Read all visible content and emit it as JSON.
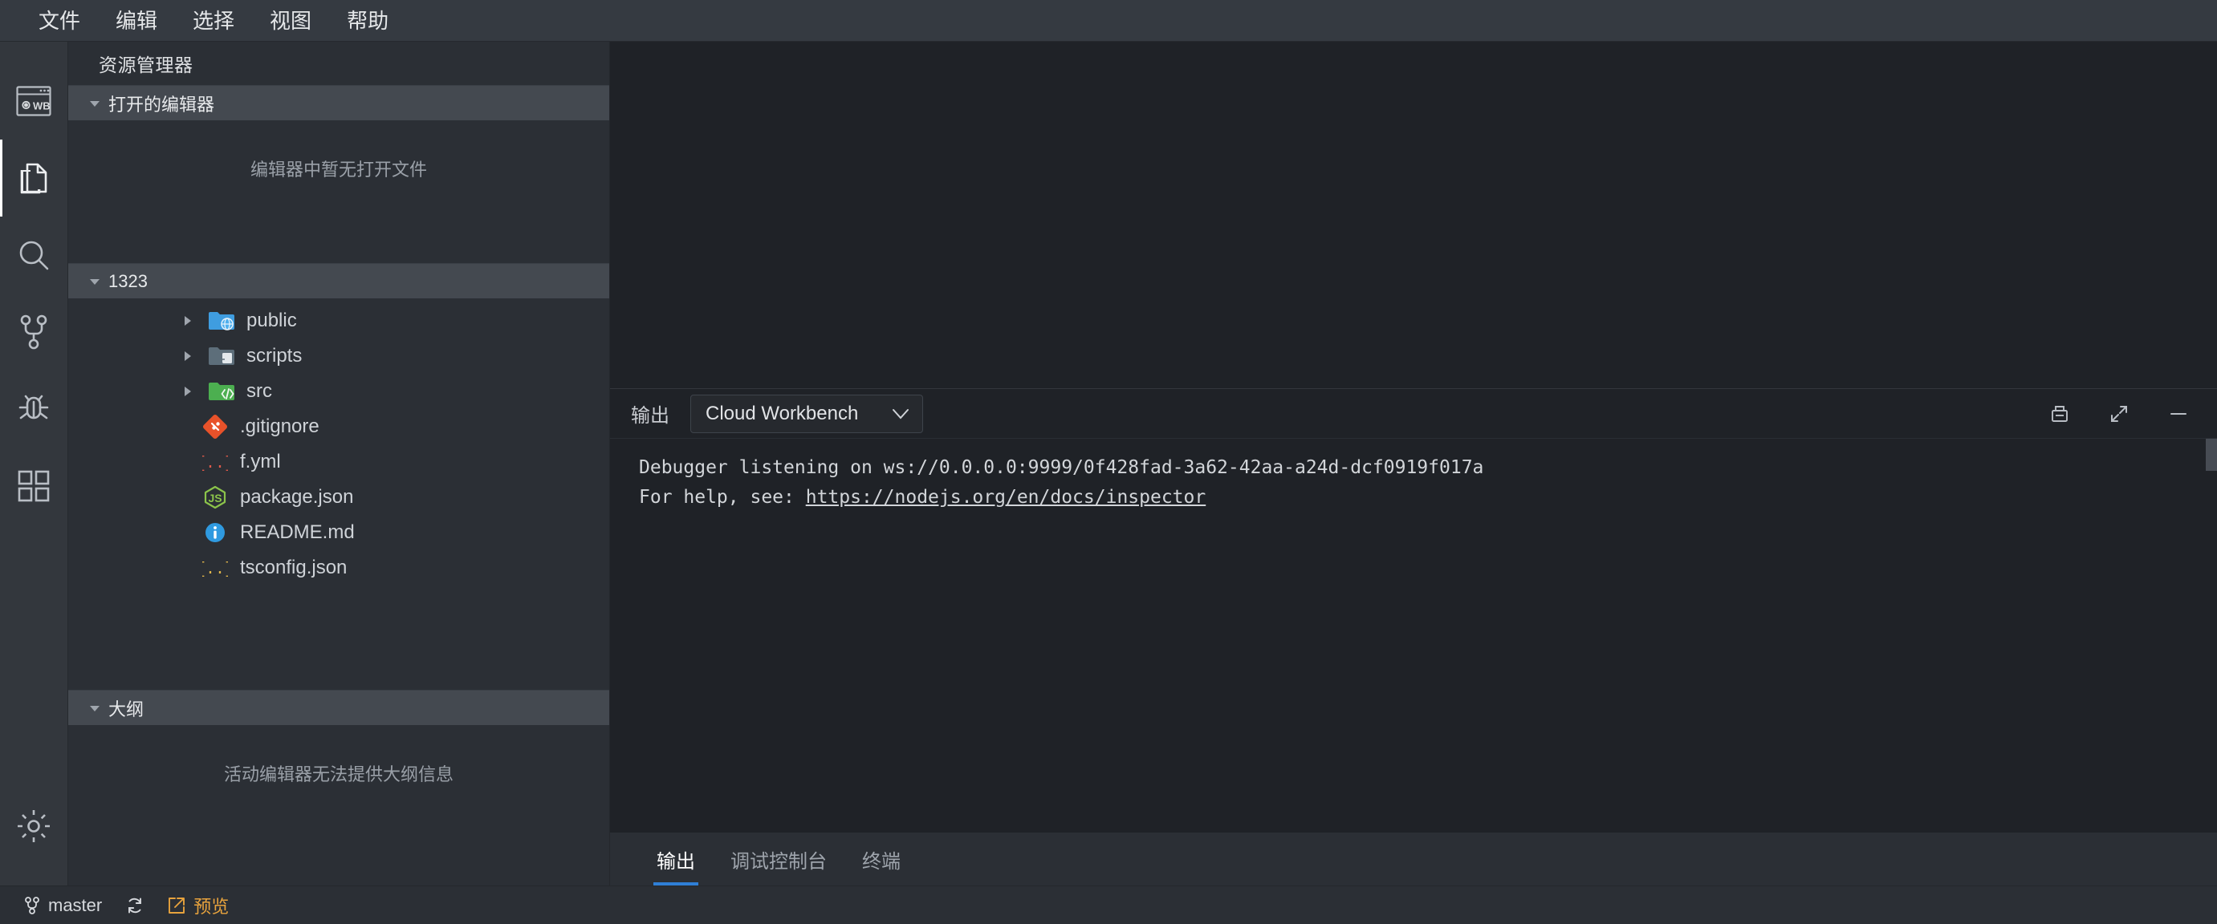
{
  "window": {
    "title": "Cloud Workbench"
  },
  "menubar": {
    "items": [
      {
        "label": "文件",
        "name": "menu-file"
      },
      {
        "label": "编辑",
        "name": "menu-edit"
      },
      {
        "label": "选择",
        "name": "menu-selection"
      },
      {
        "label": "视图",
        "name": "menu-view"
      },
      {
        "label": "帮助",
        "name": "menu-help"
      }
    ]
  },
  "activitybar": {
    "items": [
      {
        "icon": "workbench-wb-icon",
        "name": "activity-workbench",
        "active": false
      },
      {
        "icon": "files-explorer-icon",
        "name": "activity-explorer",
        "active": true
      },
      {
        "icon": "search-icon",
        "name": "activity-search",
        "active": false
      },
      {
        "icon": "source-control-icon",
        "name": "activity-source-control",
        "active": false
      },
      {
        "icon": "debug-bug-icon",
        "name": "activity-run-debug",
        "active": false
      },
      {
        "icon": "extensions-icon",
        "name": "activity-extensions",
        "active": false
      }
    ],
    "bottom": [
      {
        "icon": "gear-icon",
        "name": "activity-settings"
      }
    ]
  },
  "sidebar": {
    "title": "资源管理器",
    "open_editors": {
      "label": "打开的编辑器",
      "expanded": true,
      "empty_message": "编辑器中暂无打开文件"
    },
    "project": {
      "label": "1323",
      "expanded": true,
      "entries": [
        {
          "label": "public",
          "type": "folder",
          "icon": "folder-public-globe-icon",
          "expanded": false,
          "color": "#3f9de0"
        },
        {
          "label": "scripts",
          "type": "folder",
          "icon": "folder-scripts-icon",
          "expanded": false,
          "color": "#5d6e7a"
        },
        {
          "label": "src",
          "type": "folder",
          "icon": "folder-src-code-icon",
          "expanded": false,
          "color": "#4caf50"
        },
        {
          "label": ".gitignore",
          "type": "file",
          "icon": "git-icon",
          "color": "#e8522a"
        },
        {
          "label": "f.yml",
          "type": "file",
          "icon": "yaml-braces-icon",
          "color": "#e05a4a"
        },
        {
          "label": "package.json",
          "type": "file",
          "icon": "nodejs-icon",
          "color": "#8bc34a"
        },
        {
          "label": "README.md",
          "type": "file",
          "icon": "info-circle-icon",
          "color": "#2f9ae0"
        },
        {
          "label": "tsconfig.json",
          "type": "file",
          "icon": "json-braces-icon",
          "color": "#e0b54a"
        }
      ]
    },
    "outline": {
      "label": "大纲",
      "expanded": true,
      "empty_message": "活动编辑器无法提供大纲信息"
    }
  },
  "panel": {
    "top_label": "输出",
    "channel_selected": "Cloud Workbench",
    "channel_options": [
      "Cloud Workbench"
    ],
    "actions": [
      {
        "icon": "clear-output-icon",
        "name": "clear-output-button"
      },
      {
        "icon": "maximize-panel-icon",
        "name": "maximize-panel-button"
      },
      {
        "icon": "minimize-panel-icon",
        "name": "close-panel-button"
      }
    ],
    "log_lines": [
      {
        "text": "Debugger listening on ws://0.0.0.0:9999/0f428fad-3a62-42aa-a24d-dcf0919f017a",
        "link": null
      },
      {
        "prefix": "For help, see: ",
        "link": "https://nodejs.org/en/docs/inspector"
      }
    ],
    "tabs": [
      {
        "label": "输出",
        "name": "panel-tab-output",
        "active": true
      },
      {
        "label": "调试控制台",
        "name": "panel-tab-debug-console",
        "active": false
      },
      {
        "label": "终端",
        "name": "panel-tab-terminal",
        "active": false
      }
    ]
  },
  "statusbar": {
    "branch": "master",
    "sync_icon": "sync-icon",
    "preview_label": "预览",
    "preview_icon": "preview-window-icon",
    "accent_color": "#e8a33d"
  },
  "colors": {
    "menubar_bg": "#353a41",
    "activitybar_bg": "#33373d",
    "sidebar_bg": "#2b2f35",
    "section_header_bg": "#444950",
    "editor_bg": "#1f2227",
    "statusbar_bg": "#2b2f35",
    "tab_active_underline": "#2f7fd6"
  }
}
